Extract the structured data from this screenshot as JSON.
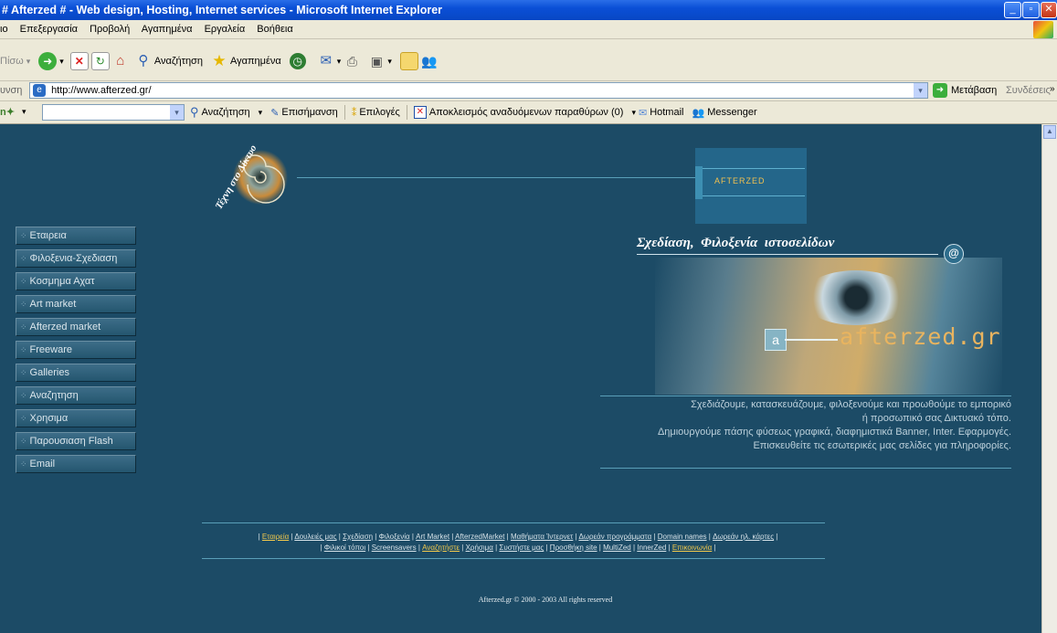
{
  "window": {
    "title": "# Afterzed # - Web design, Hosting, Internet services - Microsoft Internet Explorer"
  },
  "menu": [
    "Αρχείο",
    "Επεξεργασία",
    "Προβολή",
    "Αγαπημένα",
    "Εργαλεία",
    "Βοήθεια"
  ],
  "menu_visible": [
    "ιο",
    "Επεξεργασία",
    "Προβολή",
    "Αγαπημένα",
    "Εργαλεία",
    "Βοήθεια"
  ],
  "toolbar": {
    "back_label": "Πίσω",
    "search_label": "Αναζήτηση",
    "favorites_label": "Αγαπημένα"
  },
  "address": {
    "label": "υνση",
    "url": "http://www.afterzed.gr/",
    "go_label": "Μετάβαση",
    "links_label": "Συνδέσεις"
  },
  "links_toolbar": {
    "search_label": "Αναζήτηση",
    "highlight_label": "Επισήμανση",
    "options_label": "Επιλογές",
    "popup_label": "Αποκλεισμός αναδυόμενων παραθύρων (0)",
    "hotmail_label": "Hotmail",
    "messenger_label": "Messenger"
  },
  "page": {
    "logo_left_text": "Τέχνη στο Δίκτυο",
    "logo_right_text": "AFTERZED",
    "banner_heading": "Σχεδίαση,  Φιλοξενία  ιστοσελίδων",
    "banner_domain": "afterzed.gr",
    "banner_letter": "a",
    "banner_at": "@",
    "nav": [
      "Εταιρεια",
      "Φιλοξενια-Σχεδιαση",
      "Κοσμημα Αχατ",
      "Art market",
      "Afterzed market",
      "Freeware",
      "Galleries",
      "Αναζητηση",
      "Χρησιμα",
      "Παρουσιαση Flash",
      "Email"
    ],
    "tagline": [
      "Σχεδιάζουμε, κατασκευάζουμε, φιλοξενούμε και προωθούμε το εμπορικό",
      "ή προσωπικό σας Δικτυακό τόπο.",
      "Δημιουργούμε πάσης φύσεως γραφικά, διαφημιστικά Banner, Inter. Εφαρμογές.",
      "Επισκευθείτε τις εσωτερικές μας σελίδες για πληροφορίες."
    ],
    "footer_row1": [
      "Εταιρεία",
      "Δουλειές μας",
      "Σχεδίαση",
      "Φιλοξενία",
      "Art Market",
      "AfterzedMarket",
      "Μαθήματα Ίντερνετ",
      "Δωρεάν προγράμματα",
      "Domain names",
      "Δωρεάν ηλ. κάρτες"
    ],
    "footer_row2": [
      "Φιλικοί τόποι",
      "Screensavers",
      "Αναζητήστε",
      "Χρήσιμα",
      "Συστήστε μας",
      "Προσθήκη site",
      "MultiZed",
      "InnerZed",
      "Επικοινωνία"
    ],
    "copyright": "Afterzed.gr © 2000 - 2003  All rights reserved",
    "colors": {
      "background": "#1c4b66",
      "nav_button": "#2f607b",
      "footer_highlight": "#f2c94c"
    }
  }
}
